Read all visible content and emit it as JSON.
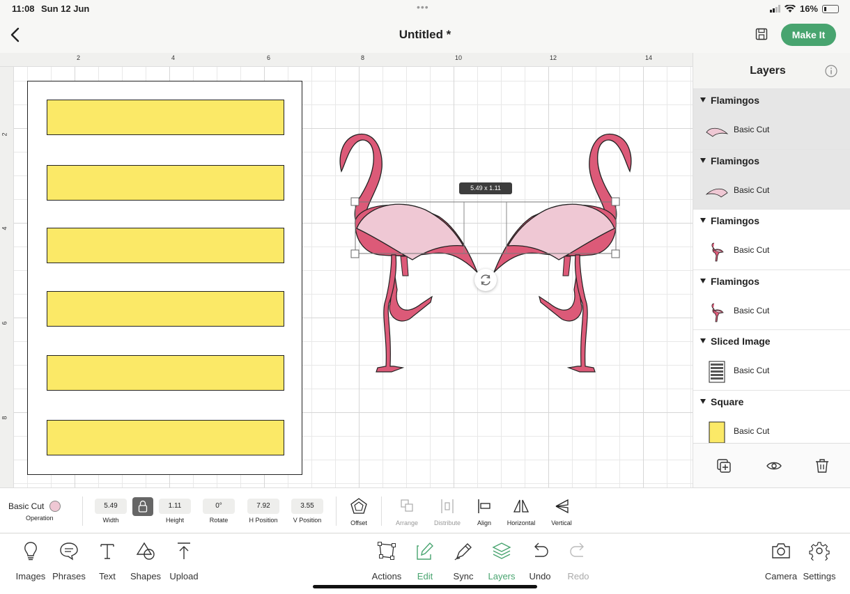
{
  "status": {
    "time": "11:08",
    "date": "Sun 12 Jun",
    "battery": "16%"
  },
  "header": {
    "title": "Untitled *",
    "make_it": "Make It"
  },
  "rulers": {
    "top": [
      "2",
      "4",
      "6",
      "8",
      "10",
      "12",
      "14"
    ],
    "left": [
      "2",
      "4",
      "6",
      "8"
    ]
  },
  "canvas": {
    "selection_size": "5.49 x 1.11"
  },
  "layers": {
    "title": "Layers",
    "groups": [
      {
        "name": "Flamingos",
        "item": "Basic Cut",
        "thumb": "wing-thumb-icon"
      },
      {
        "name": "Flamingos",
        "item": "Basic Cut",
        "thumb": "wing-thumb-icon"
      },
      {
        "name": "Flamingos",
        "item": "Basic Cut",
        "thumb": "flamingo-thumb-icon"
      },
      {
        "name": "Flamingos",
        "item": "Basic Cut",
        "thumb": "flamingo-thumb-icon"
      },
      {
        "name": "Sliced Image",
        "item": "Basic Cut",
        "thumb": "sliced-thumb-icon"
      },
      {
        "name": "Square",
        "item": "Basic Cut",
        "thumb": "square-thumb-icon"
      }
    ]
  },
  "editbar": {
    "operation_value": "Basic Cut",
    "operation_label": "Operation",
    "width_value": "5.49",
    "width_label": "Width",
    "height_value": "1.11",
    "height_label": "Height",
    "rotate_value": "0°",
    "rotate_label": "Rotate",
    "hpos_value": "7.92",
    "hpos_label": "H Position",
    "vpos_value": "3.55",
    "vpos_label": "V Position",
    "offset_label": "Offset",
    "arrange_label": "Arrange",
    "distribute_label": "Distribute",
    "align_label": "Align",
    "horizontal_label": "Horizontal",
    "vertical_label": "Vertical"
  },
  "nav": {
    "images": "Images",
    "phrases": "Phrases",
    "text": "Text",
    "shapes": "Shapes",
    "upload": "Upload",
    "actions": "Actions",
    "edit": "Edit",
    "sync": "Sync",
    "layers": "Layers",
    "undo": "Undo",
    "redo": "Redo",
    "camera": "Camera",
    "settings": "Settings"
  },
  "colors": {
    "accent": "#48a46f",
    "flamingo": "#dc5a78",
    "wing": "#efc8d4",
    "bars": "#fbe967"
  }
}
